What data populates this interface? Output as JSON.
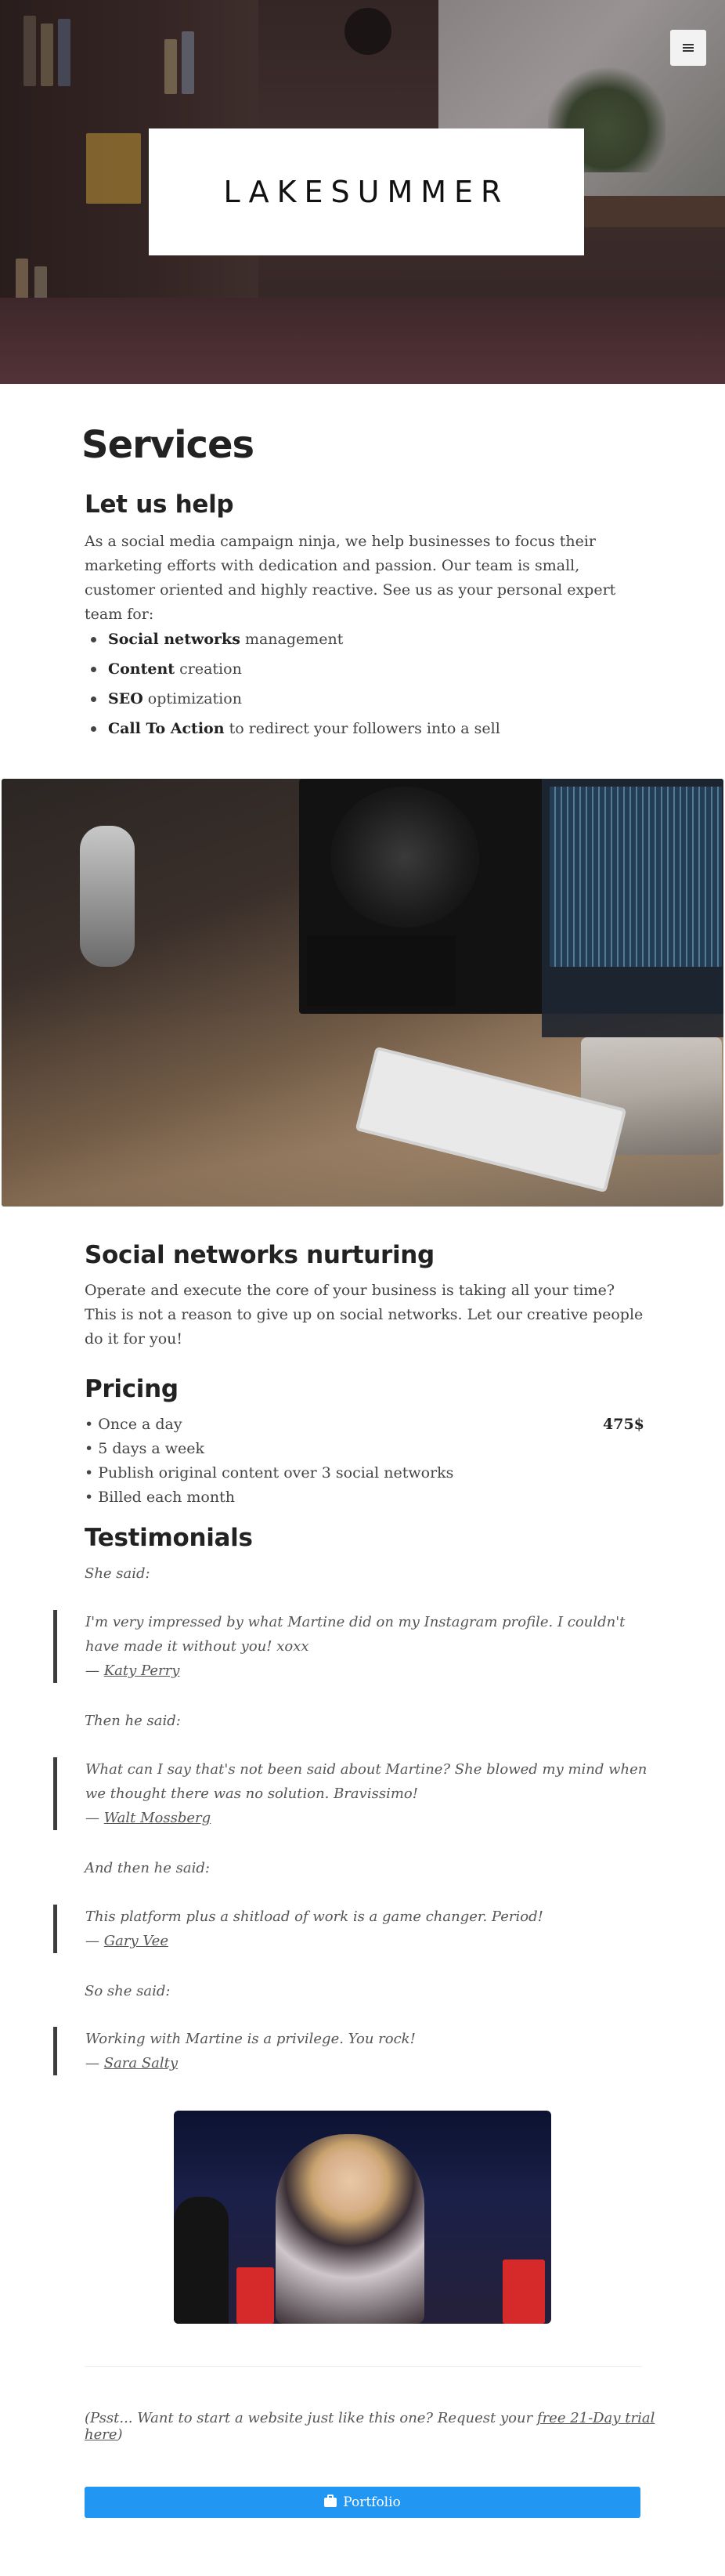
{
  "hero": {
    "brand": "LAKESUMMER",
    "menu_icon": "hamburger-menu-icon"
  },
  "services": {
    "title": "Services",
    "help_heading": "Let us help",
    "intro": "As a social media campaign ninja, we help businesses to focus their marketing efforts with dedication and passion. Our team is small, customer oriented and highly reactive. See us as your personal expert team for:",
    "items": [
      {
        "bold": "Social networks",
        "rest": " management"
      },
      {
        "bold": "Content",
        "rest": " creation"
      },
      {
        "bold": "SEO",
        "rest": " optimization"
      },
      {
        "bold": "Call To Action",
        "rest": " to redirect your followers into a sell"
      }
    ]
  },
  "nurturing": {
    "heading": "Social networks nurturing",
    "text": "Operate and execute the core of your business is taking all your time? This is not a reason to give up on social networks. Let our creative people do it for you!"
  },
  "pricing": {
    "heading": "Pricing",
    "price": "475$",
    "items": [
      "• Once a day",
      "• 5 days a week",
      "• Publish original content over 3 social networks",
      "• Billed each month"
    ]
  },
  "testimonials": {
    "heading": "Testimonials",
    "entries": [
      {
        "lead": "She said:",
        "quote": "I'm very impressed by what Martine did on my Instagram profile. I couldn't have made it without you! xoxx",
        "dash": "— ",
        "author": "Katy Perry"
      },
      {
        "lead": "Then he said:",
        "quote": "What can I say that's not been said about Martine? She blowed my mind when we thought there was no solution. Bravissimo!",
        "dash": "— ",
        "author": "Walt Mossberg"
      },
      {
        "lead": "And then he said:",
        "quote": "This platform plus a shitload of work is a game changer. Period!",
        "dash": "— ",
        "author": "Gary Vee"
      },
      {
        "lead": "So she said:",
        "quote": "Working with Martine is a privilege. You rock!",
        "dash": "— ",
        "author": "Sara Salty"
      }
    ]
  },
  "footer": {
    "psst_before": "(Psst... Want to start a website just like this one? Request your ",
    "psst_link": "free 21-Day trial here",
    "psst_after": ")",
    "portfolio_label": "Portfolio",
    "portfolio_icon": "briefcase-icon",
    "button_color": "#2196f3"
  }
}
